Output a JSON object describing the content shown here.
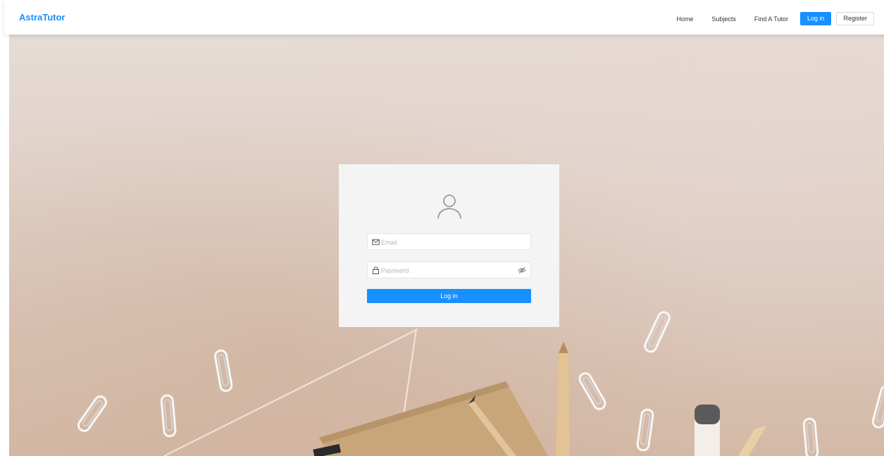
{
  "app": {
    "brand": "AstraTutor"
  },
  "nav": {
    "links": [
      {
        "label": "Home"
      },
      {
        "label": "Subjects"
      },
      {
        "label": "Find A Tutor"
      }
    ],
    "login_label": "Log in",
    "register_label": "Register"
  },
  "login_form": {
    "avatar_icon": "user-icon",
    "email": {
      "placeholder": "Email",
      "value": "",
      "icon": "mail-icon"
    },
    "password": {
      "placeholder": "Password",
      "value": "",
      "icon": "lock-icon",
      "toggle_icon": "eye-off-icon"
    },
    "submit_label": "Log in"
  },
  "colors": {
    "accent": "#1890ff",
    "card_bg": "#f4f4f4"
  }
}
